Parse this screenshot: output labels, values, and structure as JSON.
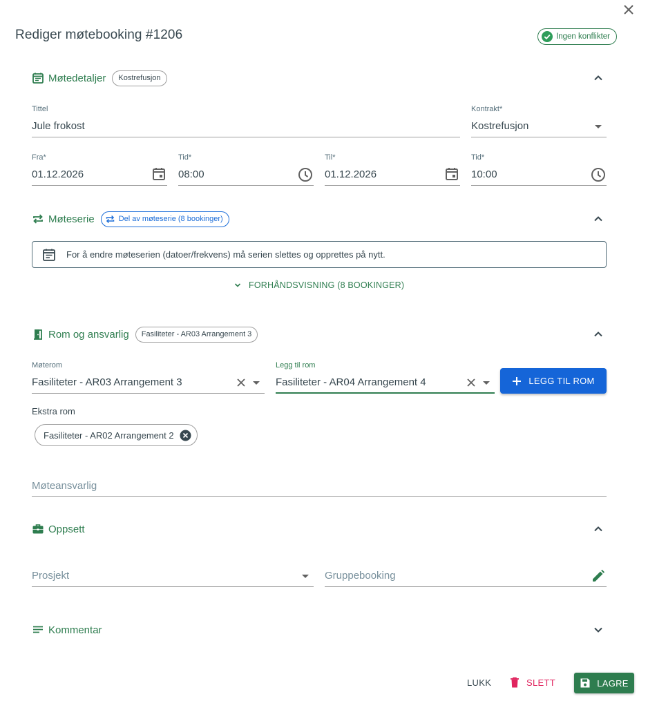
{
  "dialog": {
    "title": "Rediger møtebooking #1206",
    "status_chip": "Ingen konflikter"
  },
  "meeting_details": {
    "title": "Møtedetaljer",
    "chip": "Kostrefusjon",
    "title_field": {
      "label": "Tittel",
      "value": "Jule frokost"
    },
    "contract_field": {
      "label": "Kontrakt*",
      "value": "Kostrefusjon"
    },
    "from_date": {
      "label": "Fra*",
      "value": "01.12.2026"
    },
    "from_time": {
      "label": "Tid*",
      "value": "08:00"
    },
    "to_date": {
      "label": "Til*",
      "value": "01.12.2026"
    },
    "to_time": {
      "label": "Tid*",
      "value": "10:00"
    }
  },
  "meeting_series": {
    "title": "Møteserie",
    "chip": "Del av møteserie (8 bookinger)",
    "info": "For å endre møteserien (datoer/frekvens) må serien slettes og opprettes på nytt.",
    "preview_link": "FORHÅNDSVISNING (8 BOOKINGER)"
  },
  "room": {
    "title": "Rom og ansvarlig",
    "chip": "Fasiliteter - AR03 Arrangement 3",
    "meeting_room": {
      "label": "Møterom",
      "value": "Fasiliteter - AR03 Arrangement 3"
    },
    "add_room": {
      "label": "Legg til rom",
      "value": "Fasiliteter - AR04 Arrangement 4"
    },
    "add_room_button": "LEGG TIL ROM",
    "extra_rooms_label": "Ekstra rom",
    "extra_rooms": [
      "Fasiliteter - AR02 Arrangement 2"
    ],
    "responsible_placeholder": "Møteansvarlig"
  },
  "setup": {
    "title": "Oppsett",
    "project_placeholder": "Prosjekt",
    "group_booking_placeholder": "Gruppebooking"
  },
  "comment": {
    "title": "Kommentar"
  },
  "footer": {
    "close": "LUKK",
    "delete": "SLETT",
    "save": "LAGRE"
  },
  "colors": {
    "accent_green": "#2e7d4f",
    "primary_blue": "#1565d8",
    "delete_red": "#e0245e"
  }
}
